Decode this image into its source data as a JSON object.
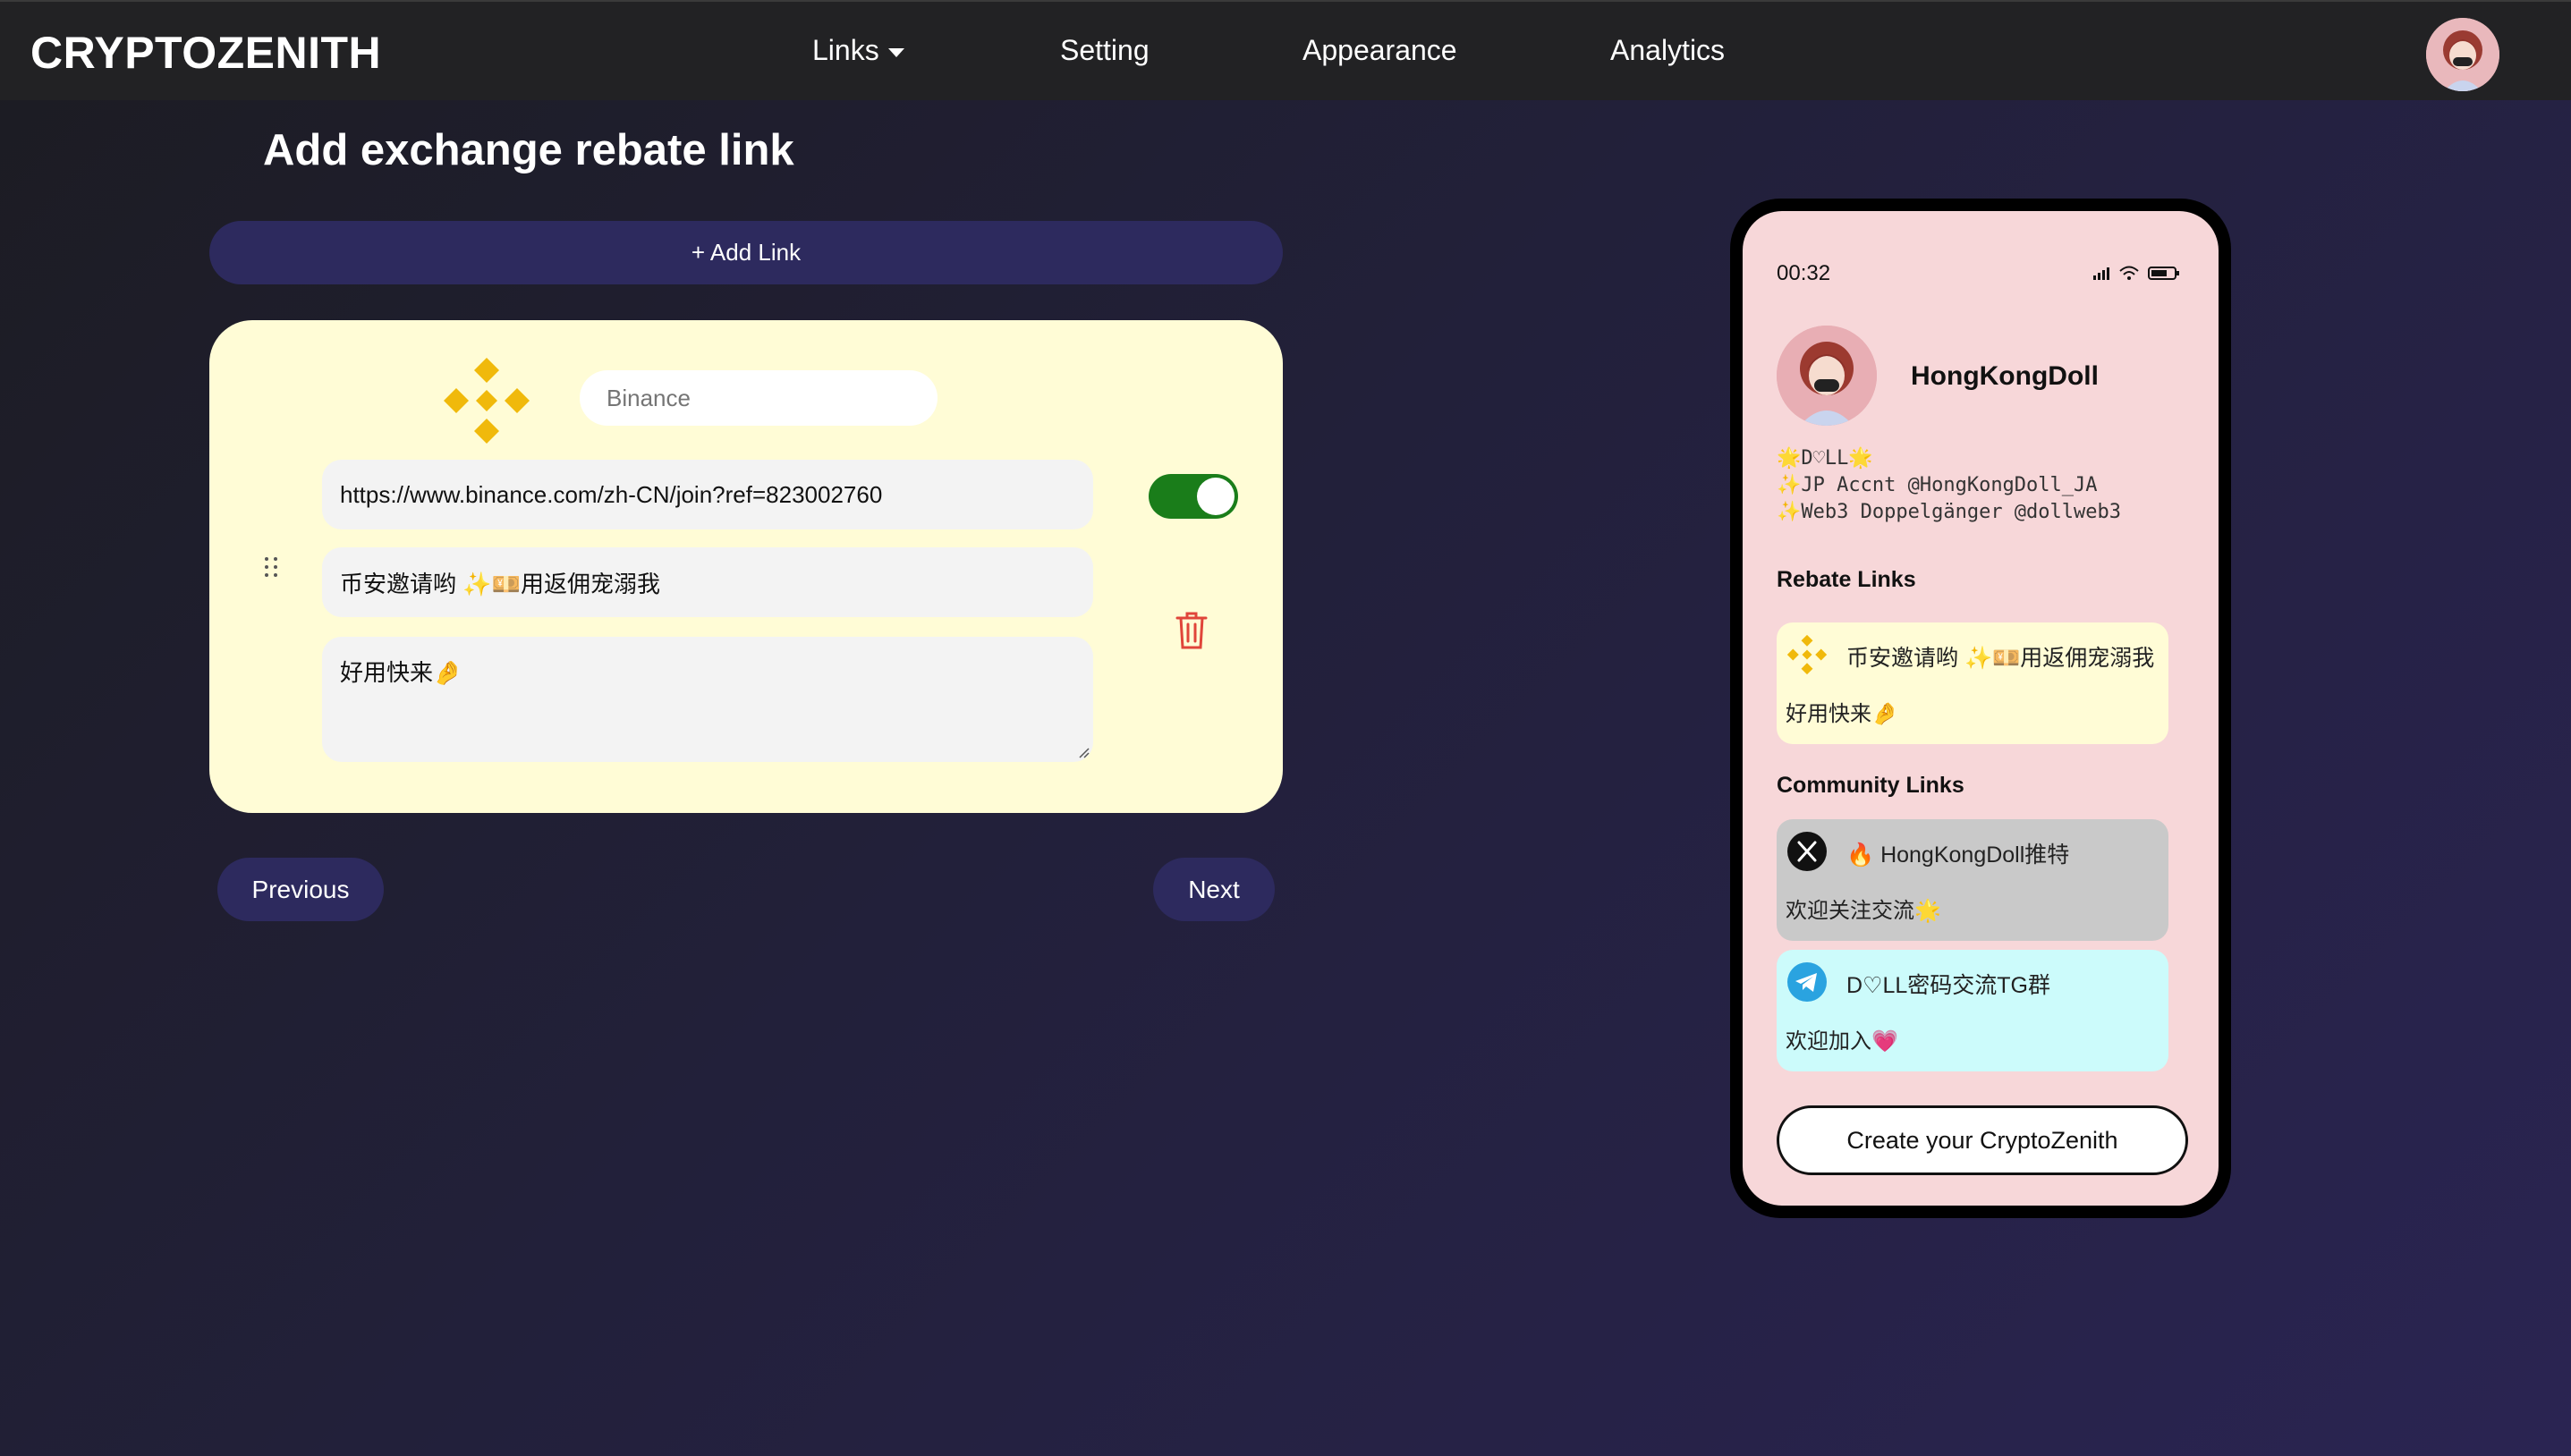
{
  "brand": "CRYPTOZENITH",
  "nav": {
    "links": "Links",
    "setting": "Setting",
    "appearance": "Appearance",
    "analytics": "Analytics"
  },
  "page_title": "Add exchange rebate link",
  "add_link_label": "+ Add Link",
  "link_card": {
    "name_placeholder": "Binance",
    "url": "https://www.binance.com/zh-CN/join?ref=823002760",
    "title": "币安邀请哟 ✨💴用返佣宠溺我",
    "description": "好用快来🤌",
    "enabled": true,
    "icons": {
      "logo": "binance-logo",
      "drag": "drag-handle-icon",
      "delete": "trash-icon"
    },
    "colors": {
      "card_bg": "#fffcd6",
      "toggle_on": "#1a7d1a",
      "trash": "#e0453a",
      "logo": "#f0b90b"
    }
  },
  "buttons": {
    "previous": "Previous",
    "next": "Next"
  },
  "preview": {
    "time": "00:32",
    "profile_name": "HongKongDoll",
    "bio": [
      "🌟D♡LL🌟",
      "✨JP Accnt @HongKongDoll_JA",
      "✨Web3 Doppelgänger @dollweb3"
    ],
    "rebate_title": "Rebate Links",
    "rebate_links": [
      {
        "icon": "binance-logo",
        "title": "币安邀请哟 ✨💴用返佣宠溺我",
        "description": "好用快来🤌"
      }
    ],
    "community_title": "Community Links",
    "community_links": [
      {
        "icon": "x-logo-icon",
        "title": "🔥 HongKongDoll推特",
        "description": "欢迎关注交流🌟"
      },
      {
        "icon": "telegram-icon",
        "title": "D♡LL密码交流TG群",
        "description": "欢迎加入💗"
      }
    ],
    "create_button": "Create your CryptoZenith",
    "colors": {
      "screen_bg": "#f7d7d9",
      "rebate_card": "#fffcd6",
      "x_card": "#c9c9c9",
      "tg_card": "#ccfbfb"
    }
  }
}
